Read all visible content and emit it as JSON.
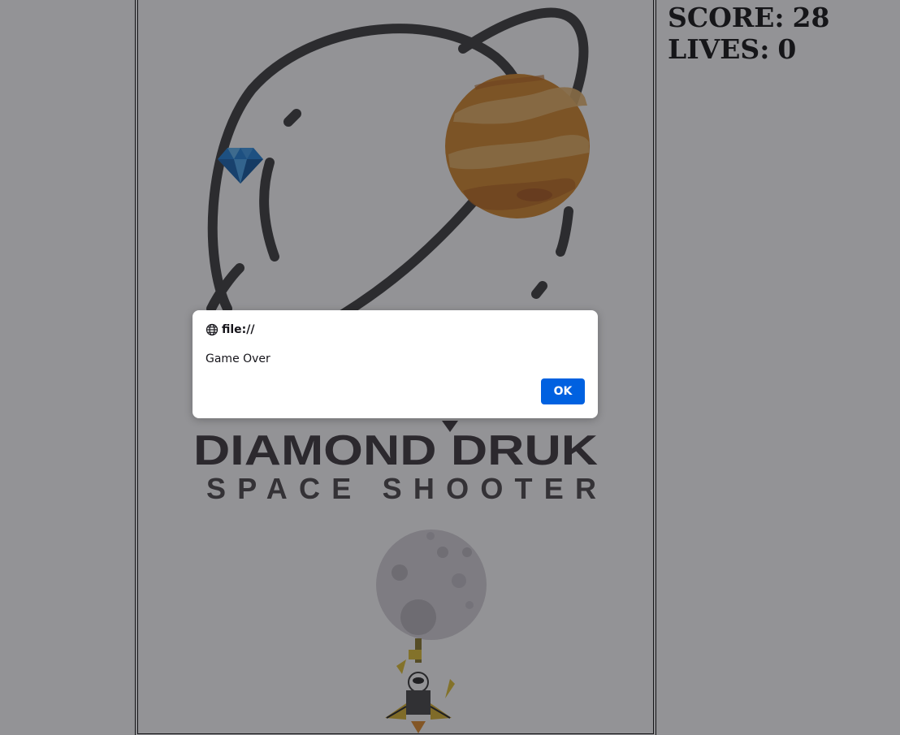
{
  "game": {
    "title_line1": "DIAMOND DRUK",
    "title_line2": "SPACE SHOOTER"
  },
  "hud": {
    "score_label": "SCORE:",
    "score_value": "28",
    "lives_label": "LIVES:",
    "lives_value": "0"
  },
  "dialog": {
    "origin": "file://",
    "message": "Game Over",
    "ok_label": "OK"
  },
  "colors": {
    "page_background": "#ffffff",
    "frame_border": "#111111",
    "planet_orange": "#d4862a",
    "diamond_blue": "#1e7fd6",
    "ok_button": "#0061e0",
    "logo_text": "#3a3538"
  },
  "icons": {
    "dialog_origin": "globe-icon",
    "collectible": "diamond-icon",
    "player": "astronaut-jetpack-ship-icon",
    "planet": "ringed-planet-icon",
    "moon": "moon-icon"
  }
}
